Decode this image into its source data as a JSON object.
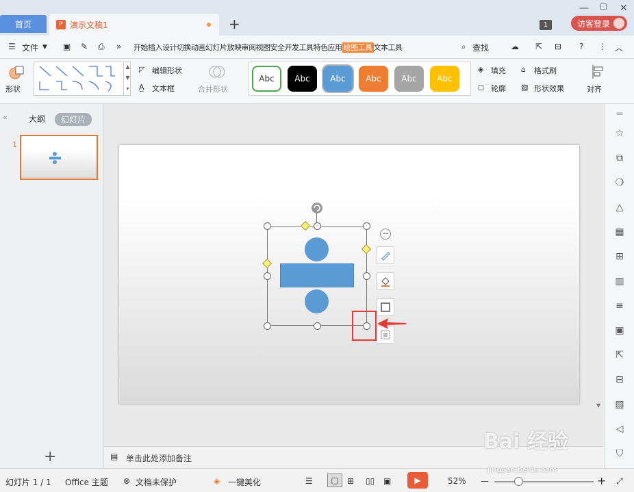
{
  "tabs": {
    "home": "首页",
    "doc": "演示文稿1"
  },
  "window": {
    "badge": "1",
    "visitor_login": "访客登录"
  },
  "menu": {
    "file": "文件",
    "items": [
      "开始",
      "插入",
      "设计",
      "切换",
      "动画",
      "幻灯片放映",
      "审阅",
      "视图",
      "安全",
      "开发工具",
      "特色应用"
    ],
    "active": "绘图工具",
    "text_tool": "文本工具",
    "search": "查找"
  },
  "ribbon": {
    "shape": "形状",
    "edit_shape": "编辑形状",
    "text_box": "文本框",
    "merge_shape": "合并形状",
    "styles": [
      "Abc",
      "Abc",
      "Abc",
      "Abc",
      "Abc",
      "Abc"
    ],
    "fill": "填充",
    "format_painter": "格式刷",
    "outline": "轮廓",
    "shape_effect": "形状效果",
    "align": "对齐"
  },
  "left_pane": {
    "outline": "大纲",
    "slides": "幻灯片",
    "slide_number": "1"
  },
  "notes": {
    "placeholder": "单击此处添加备注"
  },
  "status": {
    "slide_count": "幻灯片 1 / 1",
    "theme": "Office 主题",
    "protect": "文档未保护",
    "beautify": "一键美化",
    "zoom": "52%"
  },
  "watermark": {
    "line1": "Bai 经验",
    "line2": "jingyan.baidu.com"
  },
  "colors": {
    "accent": "#f0863a",
    "shape_blue": "#5b9bd5",
    "annotation_red": "#e53935"
  }
}
